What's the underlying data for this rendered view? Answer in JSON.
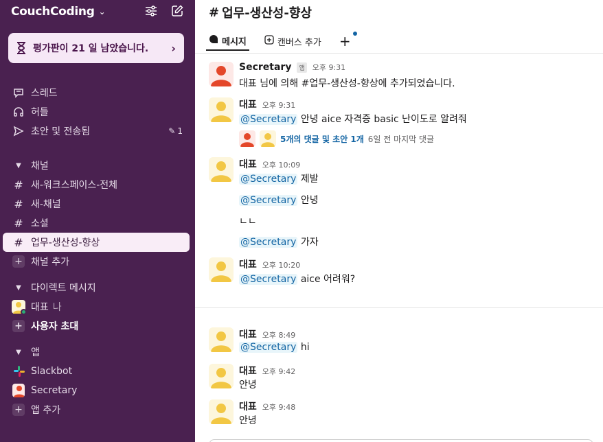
{
  "workspace": {
    "name": "CouchCoding"
  },
  "trial": {
    "text": "평가판이 21 일 남았습니다."
  },
  "sidebar": {
    "top_items": [
      {
        "label": "스레드"
      },
      {
        "label": "허들"
      },
      {
        "label": "초안 및 전송됨",
        "count": "1"
      }
    ],
    "channels_header": "채널",
    "channels": [
      {
        "label": "새-워크스페이스-전체"
      },
      {
        "label": "새-채널"
      },
      {
        "label": "소셜"
      },
      {
        "label": "업무-생산성-향상"
      }
    ],
    "add_channel": "채널 추가",
    "dm_header": "다이렉트 메시지",
    "dm_self": {
      "name": "대표",
      "you": "나"
    },
    "invite": "사용자 초대",
    "apps_header": "앱",
    "apps": [
      {
        "label": "Slackbot"
      },
      {
        "label": "Secretary"
      }
    ],
    "add_app": "앱 추가"
  },
  "channel": {
    "hash": "#",
    "name": "업무-생산성-향상",
    "tabs": [
      {
        "label": "메시지"
      },
      {
        "label": "캔버스 추가"
      }
    ],
    "tab_plus": "+"
  },
  "messages": {
    "m1": {
      "sender": "Secretary",
      "badge": "앱",
      "time": "오후 9:31",
      "text": "대표 님에 의해 #업무-생산성-향상에 추가되었습니다."
    },
    "m2": {
      "sender": "대표",
      "time": "오후 9:31",
      "mention": "@Secretary",
      "text": " 안녕 aice 자격증 basic 난이도로 알려줘",
      "thread_count": "5개의 댓글 및 초안 1개",
      "thread_last": "6일 전 마지막 댓글"
    },
    "m3": {
      "sender": "대표",
      "time": "오후 10:09",
      "l1_mention": "@Secretary",
      "l1": " 제발",
      "l2_mention": "@Secretary",
      "l2": " 안녕",
      "l3": "ㄴㄴ",
      "l4_mention": "@Secretary",
      "l4": " 가자"
    },
    "m4": {
      "sender": "대표",
      "time": "오후 10:20",
      "mention": "@Secretary",
      "text": " aice 어려워?"
    },
    "m5": {
      "sender": "대표",
      "time": "오후 8:49",
      "mention": "@Secretary",
      "text": " hi"
    },
    "m6": {
      "sender": "대표",
      "time": "오후 9:42",
      "text": "안녕"
    },
    "m7": {
      "sender": "대표",
      "time": "오후 9:48",
      "text": "안녕"
    }
  },
  "colors": {
    "sidebar": "#4a2150",
    "active": "#f9edf7",
    "link": "#1264a3",
    "user_avatar": "#f2c744",
    "bot_avatar": "#e4472a"
  }
}
